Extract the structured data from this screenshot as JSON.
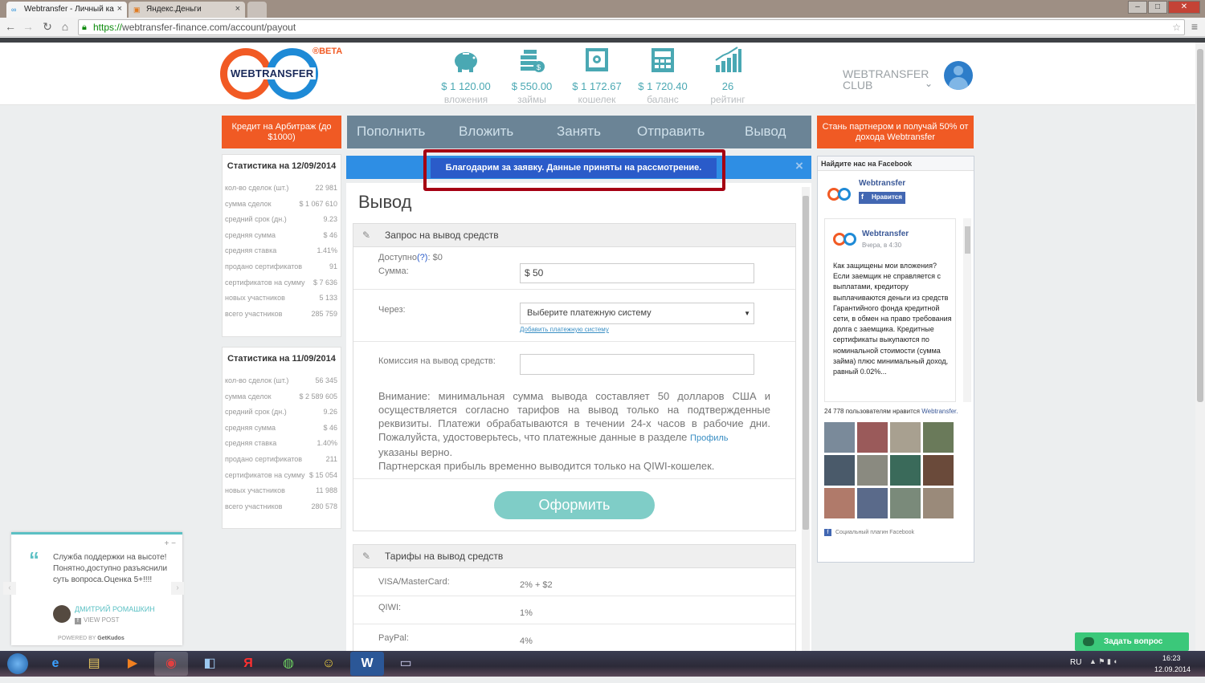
{
  "browser": {
    "tabs": [
      {
        "title": "Webtransfer - Личный ка",
        "close": "×"
      },
      {
        "title": "Яндекс.Деньги",
        "close": "×"
      }
    ],
    "url_scheme": "https://",
    "url_rest": "webtransfer-finance.com/account/payout"
  },
  "header": {
    "logo_text": "WEBTRANSFER",
    "beta": "®BETA",
    "stats": [
      {
        "value": "$ 1 120.00",
        "label": "вложения",
        "icon": "piggy-bank-icon"
      },
      {
        "value": "$ 550.00",
        "label": "займы",
        "icon": "coins-icon"
      },
      {
        "value": "$ 1 172.67",
        "label": "кошелек",
        "icon": "safe-icon"
      },
      {
        "value": "$ 1 720.40",
        "label": "баланс",
        "icon": "calculator-icon"
      },
      {
        "value": "26",
        "label": "рейтинг",
        "icon": "rating-chart-icon"
      }
    ],
    "club": "WEBTRANSFER CLUB",
    "colors": {
      "accent": "#4aa8b3",
      "orange": "#f05a24",
      "nav": "#6b8496"
    }
  },
  "promo_left": "Кредит на Арбитраж (до $1000)",
  "promo_right": "Стань партнером и получай 50% от дохода Webtransfer",
  "nav": [
    "Пополнить",
    "Вложить",
    "Занять",
    "Отправить",
    "Вывод"
  ],
  "stats_blocks": [
    {
      "title": "Статистика на 12/09/2014",
      "rows": [
        [
          "кол-во сделок (шт.)",
          "22 981"
        ],
        [
          "сумма сделок",
          "$ 1 067 610"
        ],
        [
          "средний срок (дн.)",
          "9.23"
        ],
        [
          "средняя сумма",
          "$ 46"
        ],
        [
          "средняя ставка",
          "1.41%"
        ],
        [
          "продано сертификатов",
          "91"
        ],
        [
          "сертификатов на сумму",
          "$ 7 636"
        ],
        [
          "новых участников",
          "5 133"
        ],
        [
          "всего участников",
          "285 759"
        ]
      ]
    },
    {
      "title": "Статистика на 11/09/2014",
      "rows": [
        [
          "кол-во сделок (шт.)",
          "56 345"
        ],
        [
          "сумма сделок",
          "$ 2 589 605"
        ],
        [
          "средний срок (дн.)",
          "9.26"
        ],
        [
          "средняя сумма",
          "$ 46"
        ],
        [
          "средняя ставка",
          "1.40%"
        ],
        [
          "продано сертификатов",
          "211"
        ],
        [
          "сертификатов на сумму",
          "$ 15 054"
        ],
        [
          "новых участников",
          "11 988"
        ],
        [
          "всего участников",
          "280 578"
        ]
      ]
    }
  ],
  "main": {
    "notice": "Благодарим за заявку. Данные приняты на рассмотрение.",
    "close": "×",
    "title": "Вывод",
    "request_section": "Запрос на вывод средств",
    "available_label": "Доступно",
    "available_help": "(?)",
    "available_value": ": $0",
    "amount_label": "Сумма:",
    "amount_value": "$ 50",
    "via_label": "Через:",
    "via_select": "Выберите платежную систему",
    "add_system_link": "Добавить платежную систему",
    "fee_label": "Комиссия на вывод средств:",
    "fee_value": "",
    "attention_1": "Внимание: минимальная сумма вывода составляет 50 долларов США и осуществляется согласно тарифов на вывод только на подтвержденные реквизиты. Платежи обрабатываются в течении 24-х часов в рабочие дни. Пожалуйста, удостоверьтесь, что платежные данные в разделе",
    "profile_link": "Профиль",
    "attention_2": "указаны верно.",
    "attention_3": "Партнерская прибыль временно выводится только на QIWI-кошелек.",
    "submit": "Оформить",
    "tariffs_section": "Тарифы на вывод средств",
    "tariffs": [
      {
        "name": "VISA/MasterCard:",
        "fee": "2% + $2"
      },
      {
        "name": "QIWI:",
        "fee": "1%"
      },
      {
        "name": "PayPal:",
        "fee": "4%"
      }
    ]
  },
  "facebook": {
    "header": "Найдите нас на Facebook",
    "page_name": "Webtransfer",
    "like_button": "Нравится",
    "post_author": "Webtransfer",
    "post_time": "Вчера, в 4:30",
    "post_title": "Как защищены мои вложения?",
    "post_body": "Если заемщик не справляется с выплатами, кредитору выплачиваются деньги из средств Гарантийного фонда кредитной сети, в обмен на право требования долга с заемщика. Кредитные сертификаты выкупаются по номинальной стоимости (сумма займа) плюс минимальный доход, равный 0.02%...",
    "likes_text": "24 778 пользователям нравится",
    "likes_link": "Webtransfer.",
    "plugin": "Социальный плагин Facebook"
  },
  "chat_widget": {
    "quote": "Служба поддержки на высоте!Понятно,доступно разъяснили суть вопроса.Оценка 5+!!!!",
    "author": "ДМИТРИЙ РОМАШКИН",
    "view_post": "VIEW POST",
    "powered": "POWERED BY",
    "brand": "GetKudos",
    "controls": "+ −"
  },
  "ask_button": "Задать вопрос",
  "taskbar": {
    "lang": "RU",
    "time": "16:23",
    "date": "12.09.2014"
  }
}
